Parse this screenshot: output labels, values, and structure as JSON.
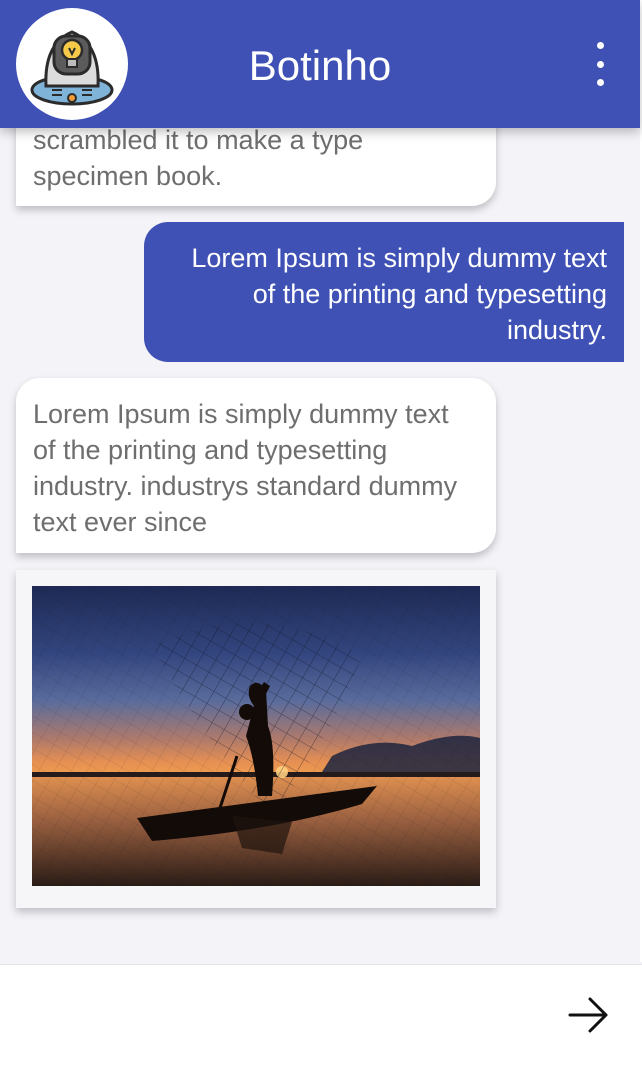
{
  "header": {
    "title": "Botinho",
    "avatar_icon": "robot-lightbulb-icon",
    "menu_icon": "more-vertical-icon",
    "color": "#3f51b5"
  },
  "messages": [
    {
      "sender": "bot",
      "text": "scrambled it to make a type specimen book."
    },
    {
      "sender": "user",
      "text": "Lorem Ipsum is simply dummy text of the printing and typesetting industry."
    },
    {
      "sender": "bot",
      "text": "Lorem Ipsum is simply dummy text of the printing and typesetting industry. industrys standard dummy text ever since"
    },
    {
      "sender": "bot",
      "type": "image",
      "image": "fisherman-casting-net-at-sunset"
    }
  ],
  "composer": {
    "value": "",
    "placeholder": "",
    "send_icon": "arrow-right-icon"
  }
}
